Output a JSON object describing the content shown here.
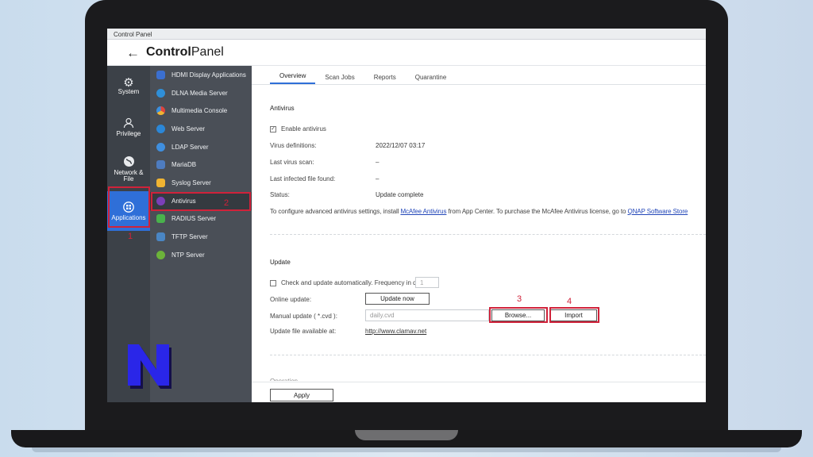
{
  "window": {
    "title": "Control Panel"
  },
  "header": {
    "title_prefix": "Control",
    "title_suffix": "Panel"
  },
  "sidebar": {
    "items": [
      {
        "label": "System",
        "icon": "gear-icon"
      },
      {
        "label": "Privilege",
        "icon": "user-icon"
      },
      {
        "label": "Network & File",
        "icon": "globe-icon"
      },
      {
        "label": "Applications",
        "icon": "apps-icon"
      }
    ]
  },
  "sublist": {
    "items": [
      {
        "label": "HDMI Display Applications",
        "color": "#3b6fd0"
      },
      {
        "label": "DLNA Media Server",
        "color": "#2f8fd8"
      },
      {
        "label": "Multimedia Console",
        "color": "#e0443c"
      },
      {
        "label": "Web Server",
        "color": "#2b87d8"
      },
      {
        "label": "LDAP Server",
        "color": "#3f8fdf"
      },
      {
        "label": "MariaDB",
        "color": "#4e7cc0"
      },
      {
        "label": "Syslog Server",
        "color": "#f0b432"
      },
      {
        "label": "Antivirus",
        "color": "#7b3fb8"
      },
      {
        "label": "RADIUS Server",
        "color": "#49b24c"
      },
      {
        "label": "TFTP Server",
        "color": "#4a86c4"
      },
      {
        "label": "NTP Server",
        "color": "#6cb33a"
      }
    ]
  },
  "tabs": [
    {
      "label": "Overview"
    },
    {
      "label": "Scan Jobs"
    },
    {
      "label": "Reports"
    },
    {
      "label": "Quarantine"
    }
  ],
  "antivirus": {
    "section_title": "Antivirus",
    "enable_label": "Enable antivirus",
    "virus_defs_label": "Virus definitions:",
    "virus_defs_value": "2022/12/07 03:17",
    "last_scan_label": "Last virus scan:",
    "last_scan_value": "–",
    "last_infected_label": "Last infected file found:",
    "last_infected_value": "–",
    "status_label": "Status:",
    "status_value": "Update complete",
    "info_text_1": "To configure advanced antivirus settings, install ",
    "info_link_1": "McAfee Antivirus",
    "info_text_2": " from App Center. To purchase the McAfee Antivirus license, go to ",
    "info_link_2": "QNAP Software Store"
  },
  "update": {
    "section_title": "Update",
    "auto_label": "Check and update automatically. Frequency in days:",
    "frequency_value": "1",
    "online_label": "Online update:",
    "update_now_label": "Update now",
    "manual_label": "Manual update ( *.cvd ):",
    "manual_placeholder": "daily.cvd",
    "browse_label": "Browse...",
    "import_label": "Import",
    "available_label": "Update file available at:",
    "available_link": "http://www.clamav.net"
  },
  "next_section": {
    "title": "Operation"
  },
  "footer": {
    "apply_label": "Apply"
  },
  "annotations": {
    "n1": "1",
    "n2": "2",
    "n3": "3",
    "n4": "4",
    "color": "#d0223a"
  },
  "brand": {
    "accent": "#2f6fd8"
  }
}
